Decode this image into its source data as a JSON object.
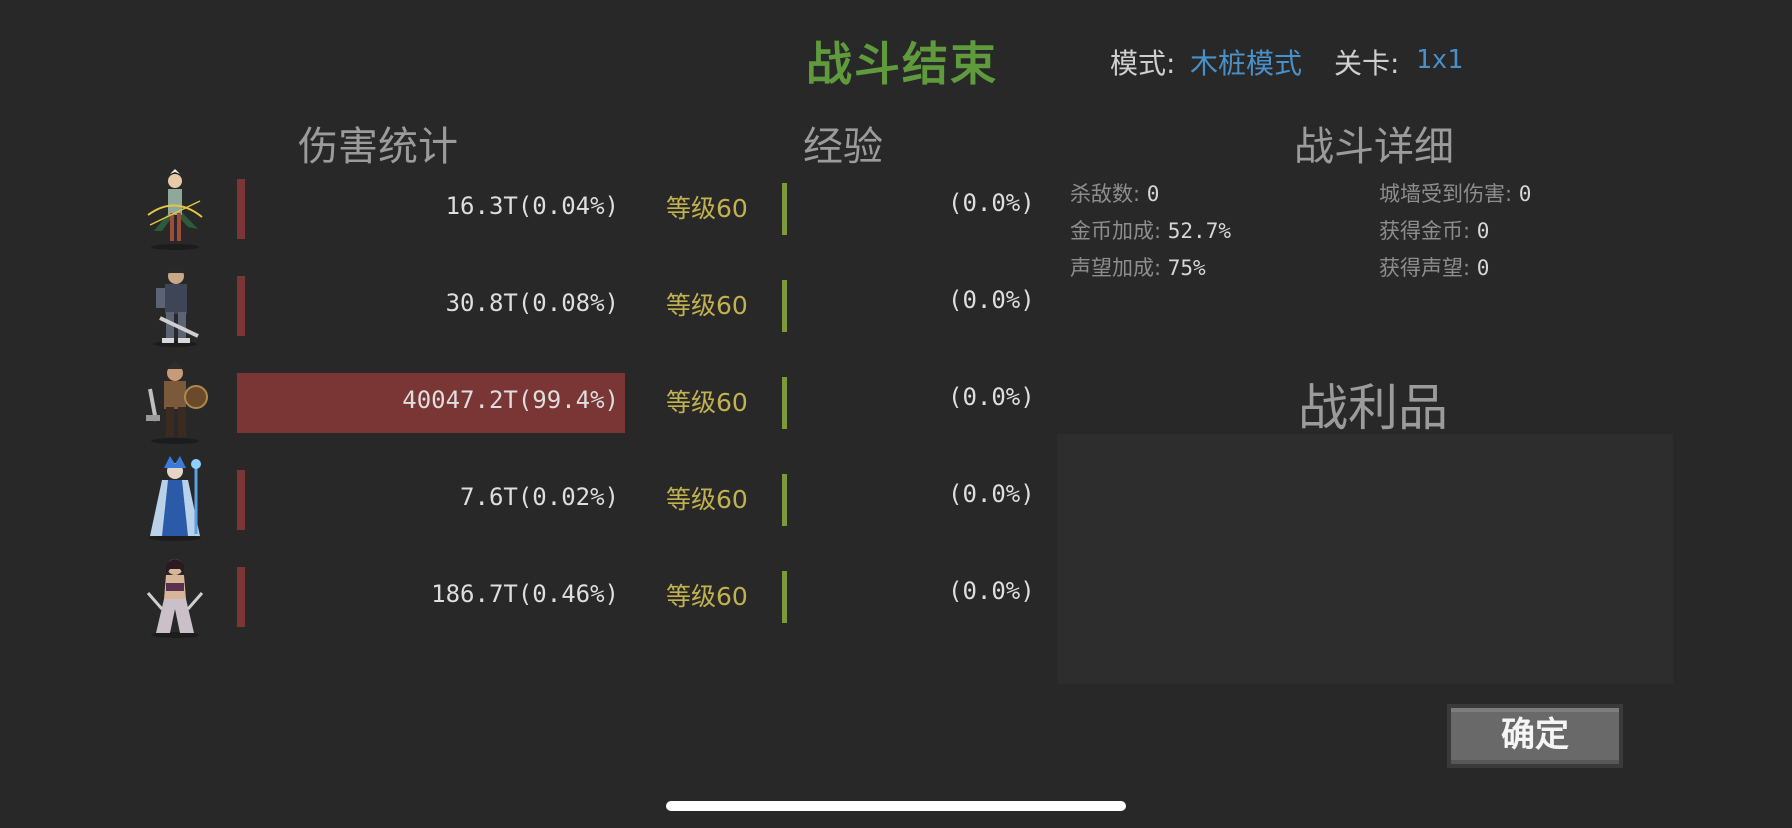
{
  "header": {
    "title": "战斗结束",
    "mode_label": "模式:",
    "mode_value": "木桩模式",
    "stage_label": "关卡:",
    "stage_value": "1x1"
  },
  "headings": {
    "damage": "伤害统计",
    "exp": "经验",
    "detail": "战斗详细",
    "loot": "战利品"
  },
  "heroes": [
    {
      "name": "hero-ranger",
      "damage": "16.3T(0.04%)",
      "damage_share": 0.0004,
      "level": "等级60",
      "exp": "(0.0%)"
    },
    {
      "name": "hero-knight",
      "damage": "30.8T(0.08%)",
      "damage_share": 0.0008,
      "level": "等级60",
      "exp": "(0.0%)"
    },
    {
      "name": "hero-warrior",
      "damage": "40047.2T(99.4%)",
      "damage_share": 0.994,
      "level": "等级60",
      "exp": "(0.0%)"
    },
    {
      "name": "hero-ice-mage",
      "damage": "7.6T(0.02%)",
      "damage_share": 0.0002,
      "level": "等级60",
      "exp": "(0.0%)"
    },
    {
      "name": "hero-assassin",
      "damage": "186.7T(0.46%)",
      "damage_share": 0.0046,
      "level": "等级60",
      "exp": "(0.0%)"
    }
  ],
  "details": {
    "kills_label": "杀敌数:",
    "kills_value": "0",
    "wall_damage_label": "城墙受到伤害:",
    "wall_damage_value": "0",
    "gold_bonus_label": "金币加成:",
    "gold_bonus_value": "52.7%",
    "gold_gained_label": "获得金币:",
    "gold_gained_value": "0",
    "fame_bonus_label": "声望加成:",
    "fame_bonus_value": "75%",
    "fame_gained_label": "获得声望:",
    "fame_gained_value": "0"
  },
  "confirm_label": "确定",
  "colors": {
    "title": "#5f9b3c",
    "accent_blue": "#4a90c8",
    "damage_bar": "#7a3535",
    "level": "#c2b24f",
    "exp_bar": "#7d9a3a"
  }
}
